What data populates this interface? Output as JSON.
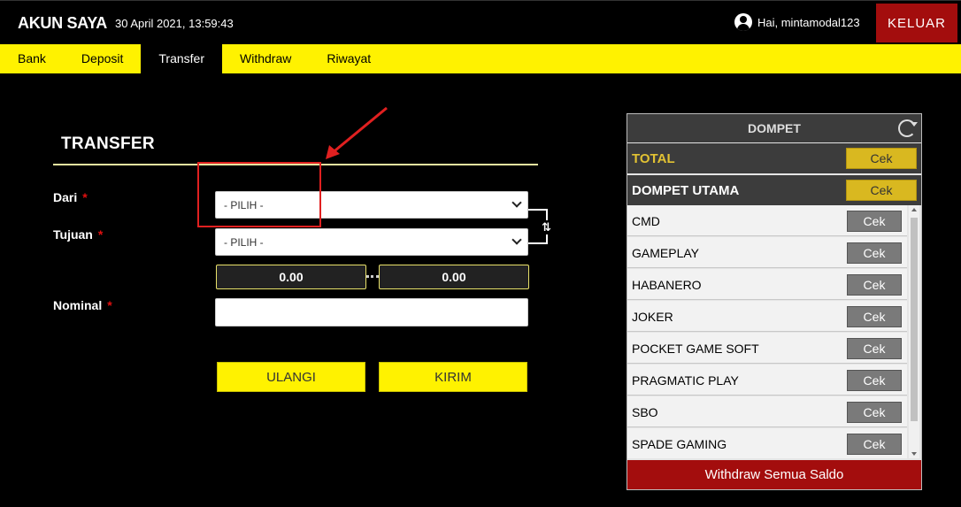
{
  "header": {
    "title": "AKUN SAYA",
    "datetime": "30 April 2021, 13:59:43",
    "greeting": "Hai, mintamodal123",
    "logout_label": "KELUAR"
  },
  "nav": {
    "items": [
      "Bank",
      "Deposit",
      "Transfer",
      "Withdraw",
      "Riwayat"
    ],
    "active": "Transfer"
  },
  "form": {
    "title": "TRANSFER",
    "from_label": "Dari",
    "to_label": "Tujuan",
    "nominal_label": "Nominal",
    "required_mark": "*",
    "from_value": "- PILIH -",
    "to_value": "- PILIH -",
    "from_balance": "0.00",
    "to_balance": "0.00",
    "nominal_value": "",
    "swap_icon": "⇅",
    "reset_label": "ULANGI",
    "submit_label": "KIRIM"
  },
  "wallet": {
    "title": "DOMPET",
    "total_label": "TOTAL",
    "main_label": "DOMPET UTAMA",
    "check_label": "Cek",
    "providers": [
      "CMD",
      "GAMEPLAY",
      "HABANERO",
      "JOKER",
      "POCKET GAME SOFT",
      "PRAGMATIC PLAY",
      "SBO",
      "SPADE GAMING"
    ],
    "withdraw_all_label": "Withdraw Semua Saldo"
  },
  "colors": {
    "accent_yellow": "#fff200",
    "gold": "#d9b820",
    "danger_red": "#a30d0d",
    "annotation_red": "#e02020"
  }
}
